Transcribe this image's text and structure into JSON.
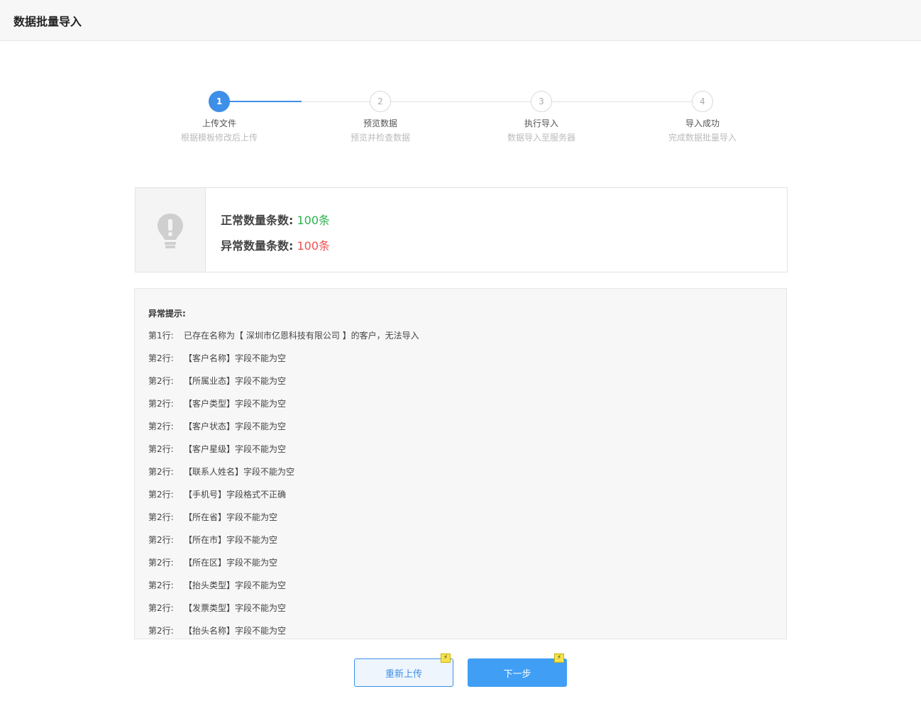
{
  "header": {
    "title": "数据批量导入"
  },
  "steps": [
    {
      "number": "1",
      "title": "上传文件",
      "desc": "根据模板修改后上传"
    },
    {
      "number": "2",
      "title": "预览数据",
      "desc": "预览并检查数据"
    },
    {
      "number": "3",
      "title": "执行导入",
      "desc": "数据导入至服务器"
    },
    {
      "number": "4",
      "title": "导入成功",
      "desc": "完成数据批量导入"
    }
  ],
  "summary": {
    "normal_label": "正常数量条数:",
    "normal_value": "100条",
    "abnormal_label": "异常数量条数:",
    "abnormal_value": "100条"
  },
  "errors": {
    "heading": "异常提示:",
    "items": [
      {
        "row": "第1行:",
        "msg": "已存在名称为【 深圳市亿恩科技有限公司 】的客户，无法导入"
      },
      {
        "row": "第2行:",
        "msg": "【客户名称】字段不能为空"
      },
      {
        "row": "第2行:",
        "msg": "【所属业态】字段不能为空"
      },
      {
        "row": "第2行:",
        "msg": "【客户类型】字段不能为空"
      },
      {
        "row": "第2行:",
        "msg": "【客户状态】字段不能为空"
      },
      {
        "row": "第2行:",
        "msg": "【客户星级】字段不能为空"
      },
      {
        "row": "第2行:",
        "msg": "【联系人姓名】字段不能为空"
      },
      {
        "row": "第2行:",
        "msg": "【手机号】字段格式不正确"
      },
      {
        "row": "第2行:",
        "msg": "【所在省】字段不能为空"
      },
      {
        "row": "第2行:",
        "msg": "【所在市】字段不能为空"
      },
      {
        "row": "第2行:",
        "msg": "【所在区】字段不能为空"
      },
      {
        "row": "第2行:",
        "msg": "【抬头类型】字段不能为空"
      },
      {
        "row": "第2行:",
        "msg": "【发票类型】字段不能为空"
      },
      {
        "row": "第2行:",
        "msg": "【抬头名称】字段不能为空"
      }
    ]
  },
  "buttons": {
    "reupload_label": "重新上传",
    "next_label": "下一步"
  },
  "colors": {
    "accent": "#409ef5",
    "ok": "#2bb24c",
    "bad": "#f05050"
  }
}
